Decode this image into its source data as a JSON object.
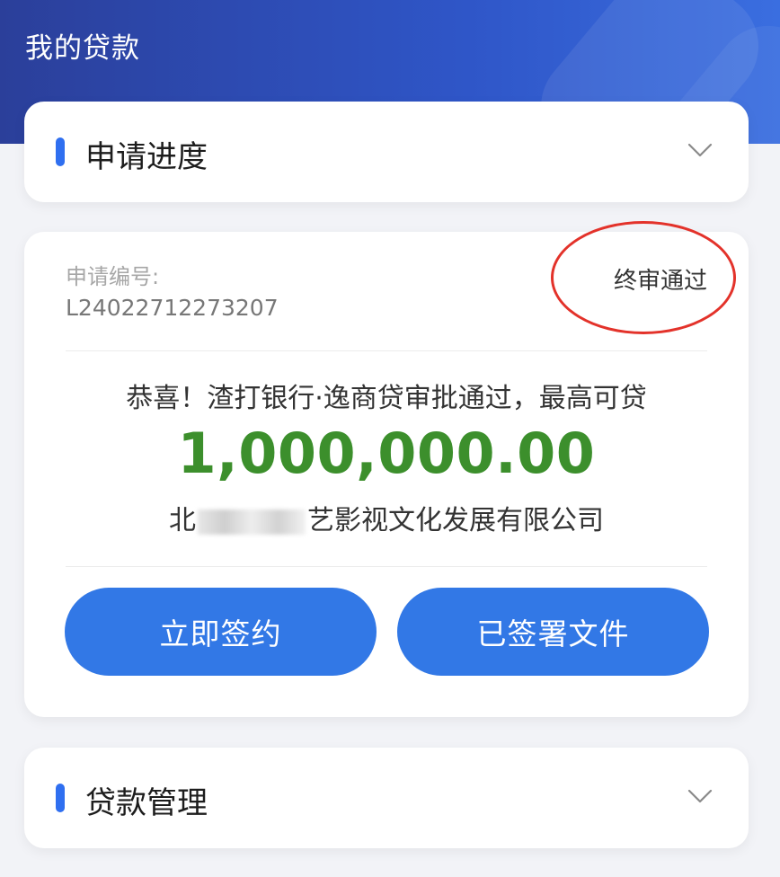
{
  "header": {
    "title": "我的贷款"
  },
  "sections": {
    "progress": {
      "title": "申请进度",
      "icon": "chevron-down-icon"
    },
    "management": {
      "title": "贷款管理",
      "icon": "chevron-down-icon"
    }
  },
  "loan": {
    "application_label": "申请编号:",
    "application_number": "L24022712273207",
    "status": "终审通过",
    "congrats": "恭喜！渣打银行·逸商贷审批通过，最高可贷",
    "amount": "1,000,000.00",
    "company_prefix": "北",
    "company_suffix": "艺影视文化发展有限公司",
    "buttons": {
      "sign_now": "立即签约",
      "signed_documents": "已签署文件"
    }
  },
  "colors": {
    "header_start": "#2b3f9a",
    "header_end": "#3a6ee0",
    "accent": "#2f6ff0",
    "amount": "#3c8f2c",
    "button": "#3278e6",
    "annotation_circle": "#e3322a"
  }
}
